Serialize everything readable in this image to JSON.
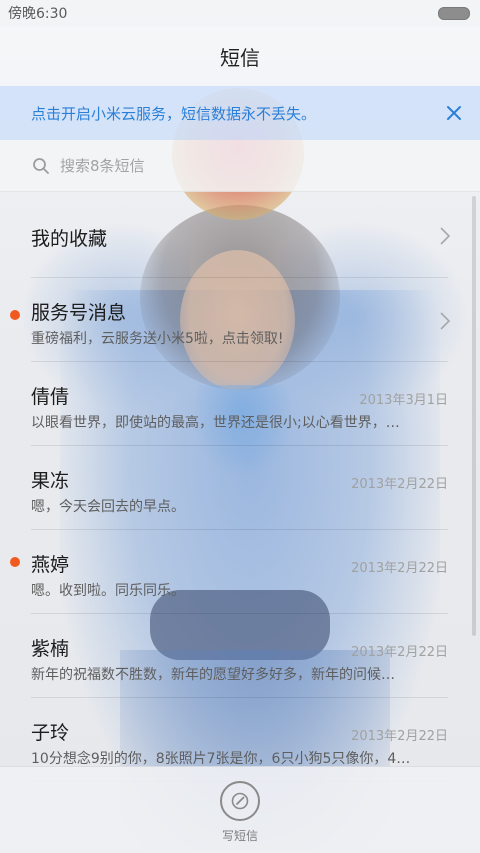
{
  "status_bar": {
    "time": "傍晚6:30"
  },
  "header": {
    "title": "短信"
  },
  "notice": {
    "text": "点击开启小米云服务，短信数据永不丢失。"
  },
  "search": {
    "placeholder": "搜索8条短信"
  },
  "favorites": {
    "label": "我的收藏"
  },
  "service": {
    "label": "服务号消息",
    "preview": "重磅福利，云服务送小米5啦，点击领取!",
    "unread": true
  },
  "threads": [
    {
      "name": "倩倩",
      "date": "2013年3月1日",
      "preview": "以眼看世界，即使站的最高，世界还是很小;以心看世界，…",
      "unread": false
    },
    {
      "name": "果冻",
      "date": "2013年2月22日",
      "preview": "嗯，今天会回去的早点。",
      "unread": false
    },
    {
      "name": "燕婷",
      "date": "2013年2月22日",
      "preview": "嗯。收到啦。同乐同乐。",
      "unread": true
    },
    {
      "name": "紫楠",
      "date": "2013年2月22日",
      "preview": "新年的祝福数不胜数，新年的愿望好多好多，新年的问候…",
      "unread": false
    },
    {
      "name": "子玲",
      "date": "2013年2月22日",
      "preview": "10分想念9别的你，8张照片7张是你，6只小狗5只像你，4…",
      "unread": false
    }
  ],
  "bottom_bar": {
    "compose_label": "写短信"
  },
  "colors": {
    "accent_blue": "#2a7fd8",
    "unread_dot": "#f05a1f",
    "banner_bg": "#d1e2f8"
  },
  "icons": {
    "close": "close-icon",
    "search": "search-icon",
    "chevron": "chevron-right-icon",
    "compose": "compose-icon"
  }
}
